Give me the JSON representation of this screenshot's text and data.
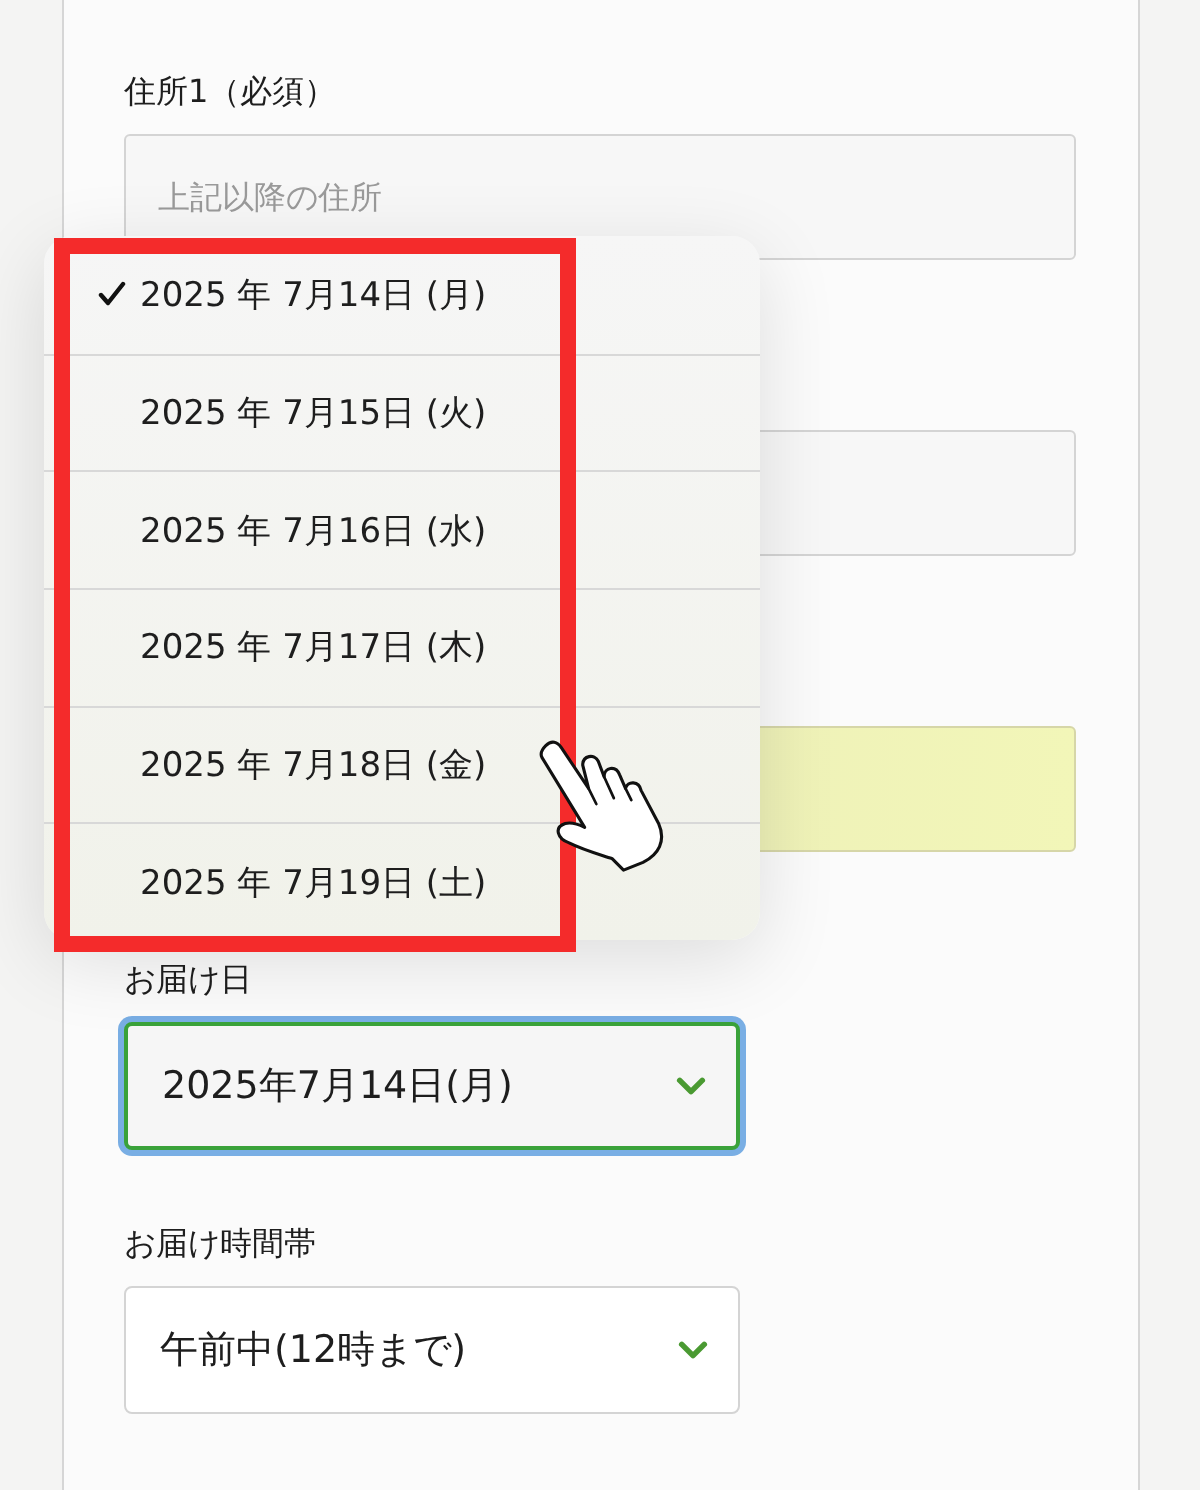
{
  "form": {
    "fields": [
      {
        "kind": "text",
        "label": "住所1（必須）",
        "placeholder": "上記以降の住所"
      },
      {
        "kind": "text"
      },
      {
        "kind": "autofill"
      }
    ],
    "selects": [
      {
        "label": "お届け日",
        "value": "2025年7月14日(月)",
        "focused": true
      },
      {
        "label": "お届け時間帯",
        "value": "午前中(12時まで)",
        "focused": false
      }
    ]
  },
  "dropdown": {
    "options": [
      {
        "label": "2025 年 7月14日 (月)",
        "selected": true
      },
      {
        "label": "2025 年 7月15日 (火)",
        "selected": false
      },
      {
        "label": "2025 年 7月16日 (水)",
        "selected": false
      },
      {
        "label": "2025 年 7月17日 (木)",
        "selected": false
      },
      {
        "label": "2025 年 7月18日 (金)",
        "selected": false
      },
      {
        "label": "2025 年 7月19日 (土)",
        "selected": false
      }
    ],
    "highlighted": true,
    "pointer": true
  }
}
